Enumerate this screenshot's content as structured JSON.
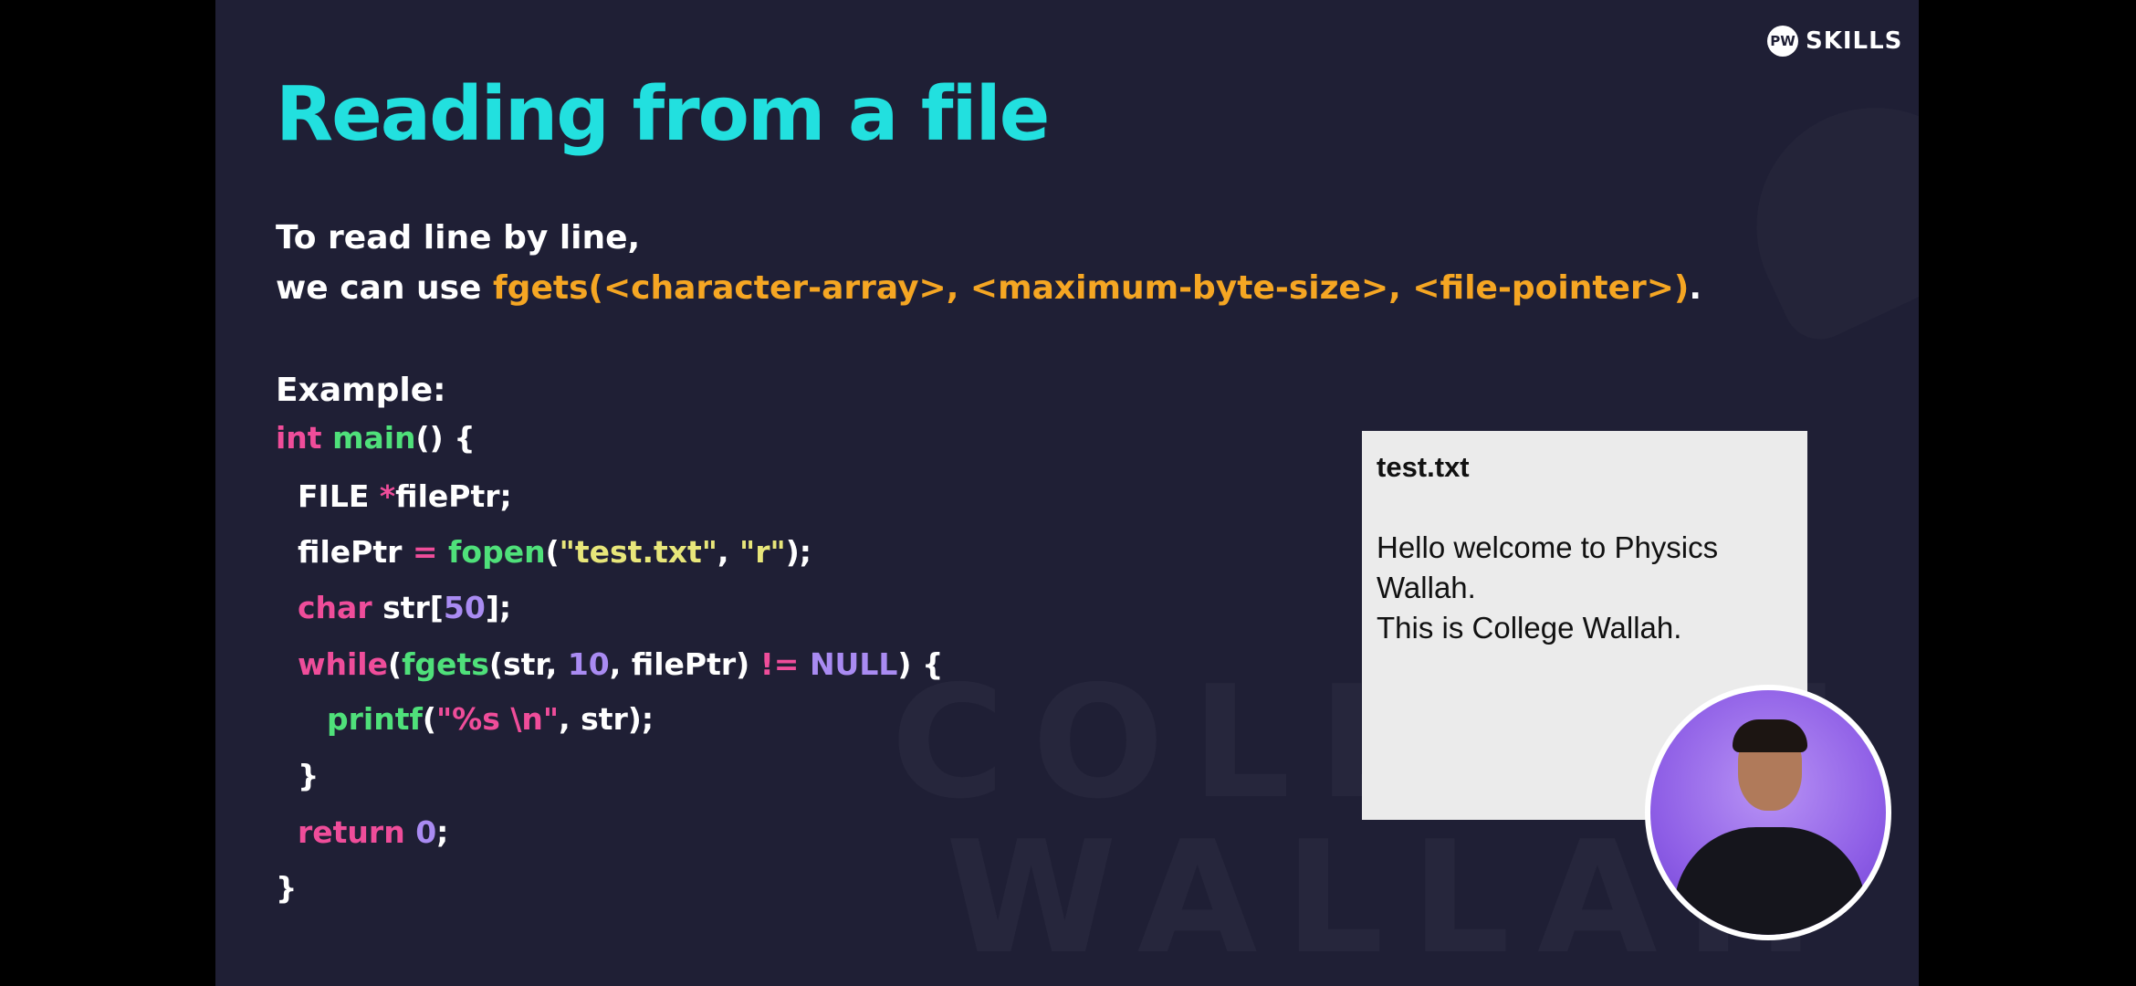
{
  "logo": {
    "mark": "PW",
    "text": "SKILLS"
  },
  "title": "Reading from a file",
  "intro": {
    "line1": "To read line by line,",
    "line2_prefix": "we can use ",
    "line2_function": "fgets(<character-array>,  <maximum-byte-size>, <file-pointer>)",
    "line2_suffix": "."
  },
  "example_label": "Example:",
  "code": [
    [
      {
        "t": "int ",
        "c": "kw"
      },
      {
        "t": "main",
        "c": "fn"
      },
      {
        "t": "() {",
        "c": ""
      }
    ],
    [
      {
        "t": "FILE ",
        "c": ""
      },
      {
        "t": "*",
        "c": "kw"
      },
      {
        "t": "filePtr;",
        "c": ""
      }
    ],
    [
      {
        "t": "filePtr ",
        "c": ""
      },
      {
        "t": "=",
        "c": "kw"
      },
      {
        "t": " ",
        "c": ""
      },
      {
        "t": "fopen",
        "c": "fn"
      },
      {
        "t": "(",
        "c": ""
      },
      {
        "t": "\"test.txt\"",
        "c": "str"
      },
      {
        "t": ", ",
        "c": ""
      },
      {
        "t": "\"r\"",
        "c": "str"
      },
      {
        "t": ");",
        "c": ""
      }
    ],
    [
      {
        "t": "char ",
        "c": "kw"
      },
      {
        "t": "str[",
        "c": ""
      },
      {
        "t": "50",
        "c": "num"
      },
      {
        "t": "];",
        "c": ""
      }
    ],
    [
      {
        "t": "while",
        "c": "kw"
      },
      {
        "t": "(",
        "c": ""
      },
      {
        "t": "fgets",
        "c": "fn"
      },
      {
        "t": "(str, ",
        "c": ""
      },
      {
        "t": "10",
        "c": "num"
      },
      {
        "t": ", filePtr) ",
        "c": ""
      },
      {
        "t": "!=",
        "c": "kw"
      },
      {
        "t": " ",
        "c": ""
      },
      {
        "t": "NULL",
        "c": "num"
      },
      {
        "t": ") {",
        "c": ""
      }
    ],
    [
      {
        "t": "printf",
        "c": "fn"
      },
      {
        "t": "(",
        "c": ""
      },
      {
        "t": "\"%s \\n\"",
        "c": "kw"
      },
      {
        "t": ", str);",
        "c": ""
      }
    ],
    [
      {
        "t": "}",
        "c": ""
      }
    ],
    [
      {
        "t": "return ",
        "c": "kw"
      },
      {
        "t": "0",
        "c": "num"
      },
      {
        "t": ";",
        "c": ""
      }
    ],
    [
      {
        "t": "}",
        "c": ""
      }
    ]
  ],
  "file_box": {
    "name": "test.txt",
    "lines": [
      "Hello welcome to Physics",
      "Wallah.",
      "This is College Wallah."
    ]
  },
  "watermark": {
    "word1": "COLLEGE",
    "word2": "WALLAH"
  },
  "colors": {
    "slide_bg": "#1f1f35",
    "title": "#22e0df",
    "function_highlight": "#f5a623",
    "keyword": "#ef4d9a",
    "function": "#4fe07a",
    "string": "#e8e67a",
    "number": "#a98bf2",
    "presenter_bg": "#8e5ee6"
  }
}
